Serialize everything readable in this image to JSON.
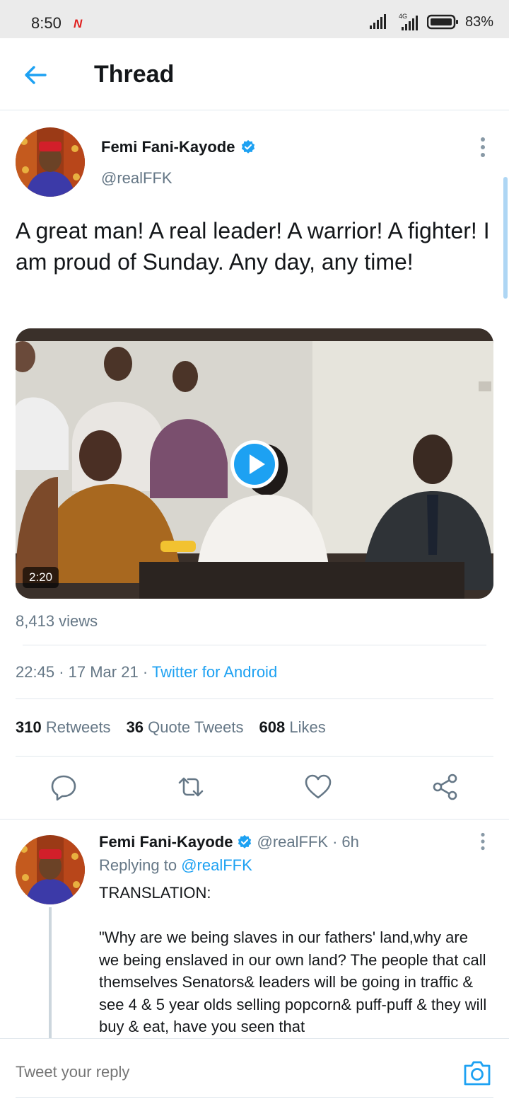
{
  "status_bar": {
    "time": "8:50",
    "network": "4G",
    "battery": "83%"
  },
  "header": {
    "title": "Thread"
  },
  "main_tweet": {
    "author_name": "Femi Fani-Kayode",
    "handle": "@realFFK",
    "text": "A great man! A real leader! A warrior! A fighter! I am proud of Sunday. Any day, any time!",
    "video_duration": "2:20",
    "views": "8,413 views",
    "time": "22:45",
    "date": "17 Mar 21",
    "source": "Twitter for Android",
    "retweets_count": "310",
    "retweets_label": "Retweets",
    "quotes_count": "36",
    "quotes_label": "Quote Tweets",
    "likes_count": "608",
    "likes_label": "Likes"
  },
  "reply": {
    "author_name": "Femi Fani-Kayode",
    "handle": "@realFFK",
    "age": "6h",
    "replying_prefix": "Replying to",
    "replying_handle": "@realFFK",
    "text": "TRANSLATION:\n\n\"Why are we being slaves in our fathers' land,why are we being enslaved in our own land? The people that call themselves Senators& leaders will be going in traffic & see 4 & 5 year olds selling popcorn& puff-puff & they will buy & eat, have you seen that"
  },
  "compose": {
    "placeholder": "Tweet your reply"
  },
  "colors": {
    "accent": "#1da1f2",
    "secondary_text": "#657786",
    "divider": "#e1e8ed"
  },
  "icons": [
    "back-arrow-icon",
    "verified-badge-icon",
    "more-vertical-icon",
    "play-icon",
    "reply-icon",
    "retweet-icon",
    "like-icon",
    "share-icon",
    "camera-icon"
  ]
}
